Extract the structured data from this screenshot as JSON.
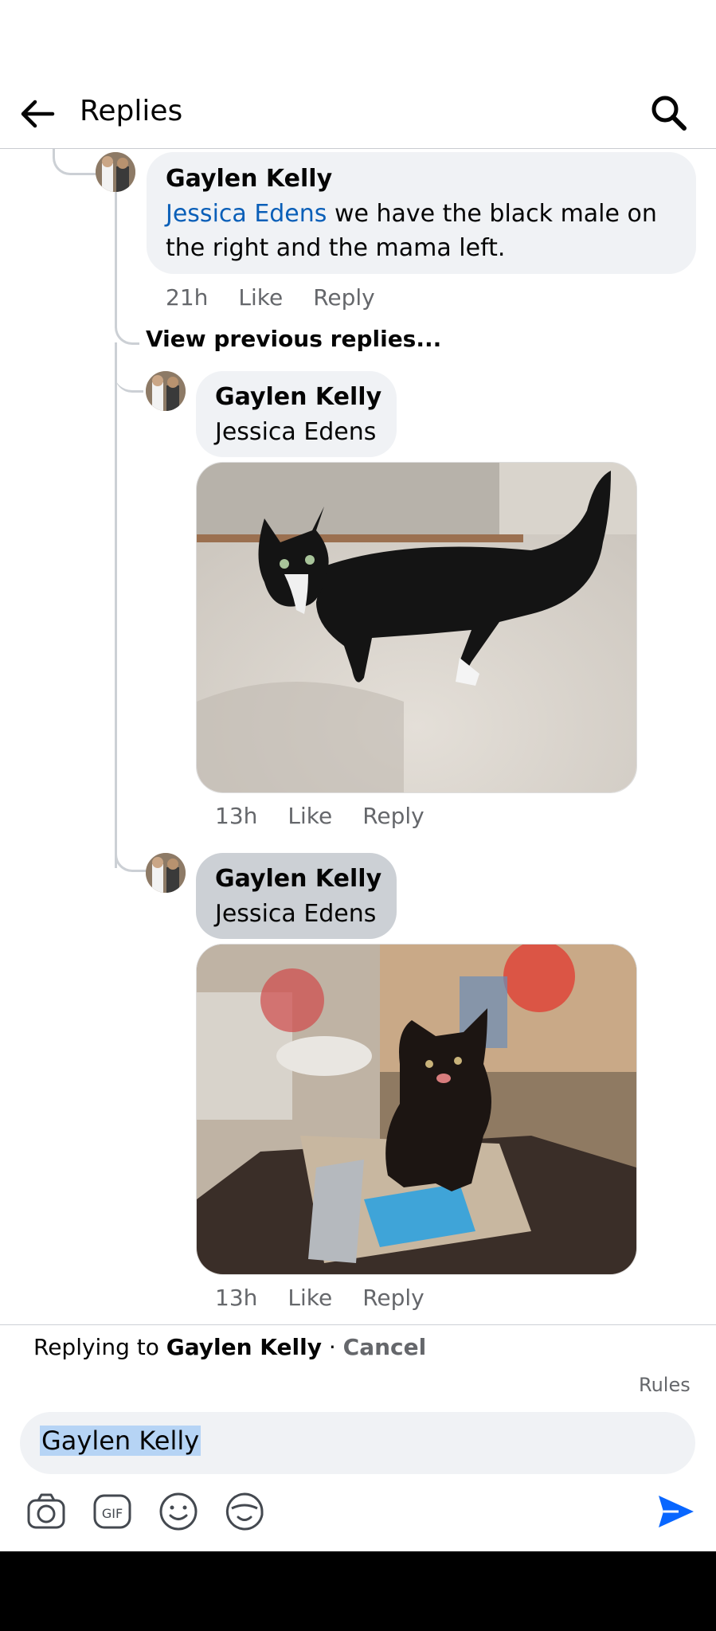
{
  "header": {
    "title": "Replies"
  },
  "comments": [
    {
      "author": "Gaylen Kelly",
      "mention": "Jessica Edens",
      "text": " we have the black male on the right and the mama left.",
      "time": "21h",
      "like": "Like",
      "reply": "Reply"
    },
    {
      "author": "Gaylen Kelly",
      "mention": "Jessica Edens",
      "time": "13h",
      "like": "Like",
      "reply": "Reply"
    },
    {
      "author": "Gaylen Kelly",
      "mention": "Jessica Edens",
      "time": "13h",
      "like": "Like",
      "reply": "Reply"
    }
  ],
  "view_previous": "View previous replies...",
  "composer": {
    "replying_prefix": "Replying to ",
    "replying_name": "Gaylen Kelly",
    "separator": " · ",
    "cancel": "Cancel",
    "rules": "Rules",
    "input_value": "Gaylen Kelly"
  },
  "icons": [
    "back-arrow-icon",
    "search-icon",
    "camera-icon",
    "gif-icon",
    "emoji-icon",
    "sticker-icon",
    "send-icon"
  ],
  "colors": {
    "mention": "#0a5fb8",
    "send": "#0866ff",
    "bubble": "#f0f2f5",
    "bubble_selected": "#ccd0d5"
  }
}
